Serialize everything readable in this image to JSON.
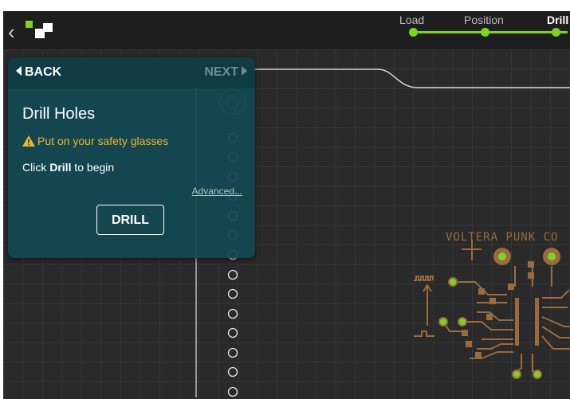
{
  "topbar": {
    "back_icon": "chevron-left-icon",
    "logo_icon": "app-logo-icon",
    "steps": [
      {
        "label": "Load"
      },
      {
        "label": "Position"
      },
      {
        "label": "Drill"
      }
    ],
    "accent_color": "#7ed321"
  },
  "panel": {
    "back_label": "BACK",
    "next_label": "NEXT",
    "title": "Drill Holes",
    "warning": "Put on your safety glasses",
    "instruction_prefix": "Click ",
    "instruction_bold": "Drill",
    "instruction_suffix": " to begin",
    "advanced_link": "Advanced...",
    "drill_button": "DRILL",
    "background_color": "#124852",
    "warning_color": "#f0b429"
  },
  "board": {
    "silkscreen_text": "VOLTERA PUNK CO",
    "trace_color": "#9a6b3c",
    "pad_color": "#7ed321"
  }
}
